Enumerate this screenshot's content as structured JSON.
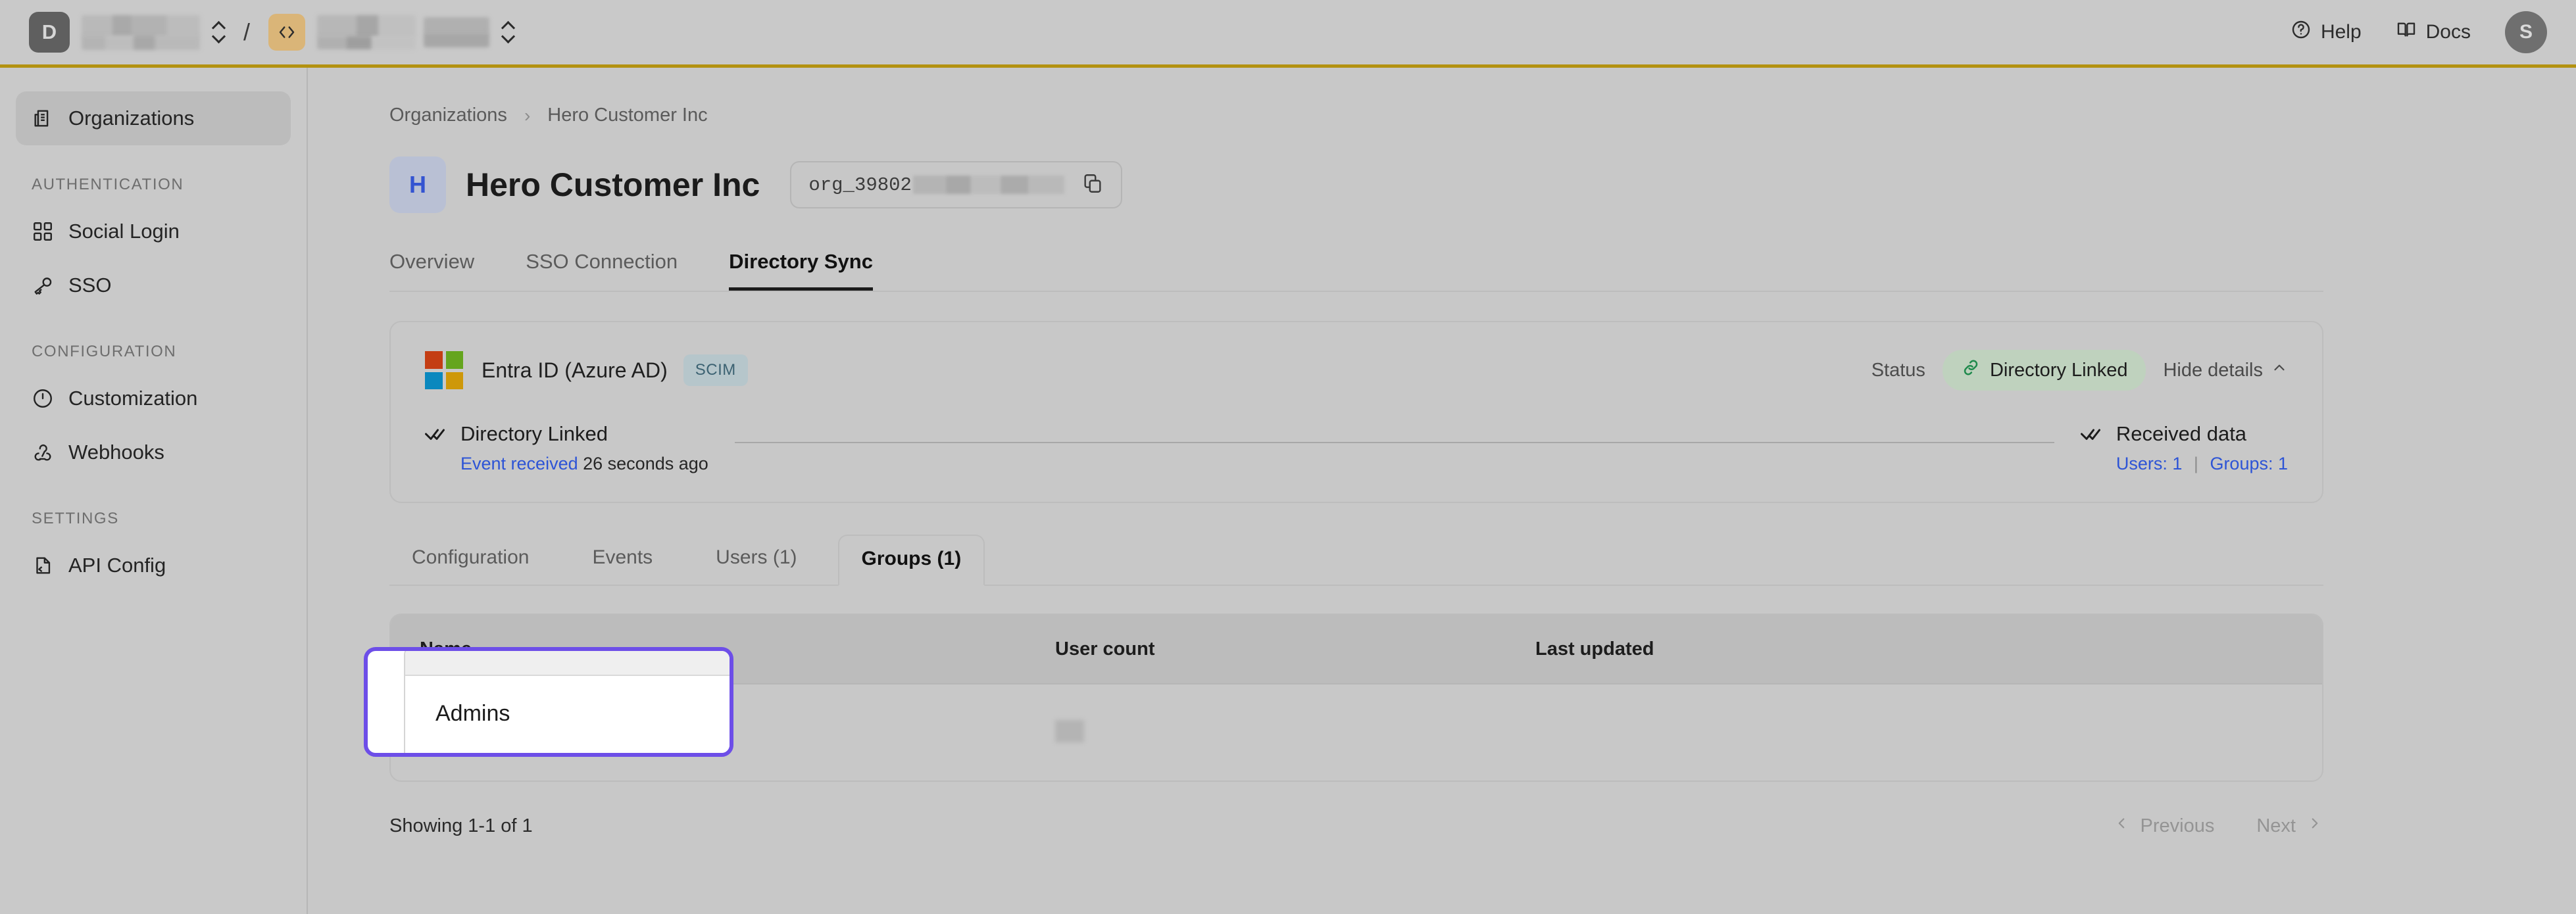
{
  "topbar": {
    "workspace_avatar": "D",
    "workspace_name_redacted": "",
    "separator": "/",
    "code_icon": "code-brackets-icon",
    "project_name_redacted": "",
    "help_label": "Help",
    "docs_label": "Docs",
    "user_avatar": "S",
    "accent_color": "#b39211"
  },
  "sidebar": {
    "items": [
      {
        "label": "Organizations",
        "icon": "organizations-icon",
        "active": true
      }
    ],
    "sections": [
      {
        "title": "AUTHENTICATION",
        "items": [
          {
            "label": "Social Login",
            "icon": "grid-icon"
          },
          {
            "label": "SSO",
            "icon": "key-icon"
          }
        ]
      },
      {
        "title": "CONFIGURATION",
        "items": [
          {
            "label": "Customization",
            "icon": "palette-icon"
          },
          {
            "label": "Webhooks",
            "icon": "webhook-icon"
          }
        ]
      },
      {
        "title": "SETTINGS",
        "items": [
          {
            "label": "API Config",
            "icon": "api-file-icon"
          }
        ]
      }
    ]
  },
  "breadcrumb": {
    "root": "Organizations",
    "separator": "›",
    "current": "Hero Customer Inc"
  },
  "org": {
    "badge_letter": "H",
    "title": "Hero Customer Inc",
    "id_prefix": "org_39802",
    "copy_icon": "copy-icon"
  },
  "tabs": [
    {
      "label": "Overview",
      "active": false
    },
    {
      "label": "SSO Connection",
      "active": false
    },
    {
      "label": "Directory Sync",
      "active": true
    }
  ],
  "directory": {
    "provider": "Entra ID (Azure AD)",
    "protocol_badge": "SCIM",
    "status_label": "Status",
    "status_value": "Directory Linked",
    "status_icon": "link-icon",
    "status_color": "#bfd2be",
    "toggle_details": "Hide details",
    "toggle_icon": "chevron-up-icon",
    "steps": [
      {
        "title": "Directory Linked",
        "icon": "double-check-icon",
        "link_text": "Event received",
        "sub_text": "26 seconds ago"
      },
      {
        "title": "Received data",
        "icon": "double-check-icon",
        "users_label": "Users: 1",
        "groups_label": "Groups: 1",
        "divider": "|"
      }
    ],
    "ms_colors": {
      "red": "#c43e14",
      "green": "#65a51e",
      "blue": "#0a88be",
      "yellow": "#ce9809"
    }
  },
  "subtabs": [
    {
      "label": "Configuration",
      "active": false
    },
    {
      "label": "Events",
      "active": false
    },
    {
      "label": "Users (1)",
      "active": false
    },
    {
      "label": "Groups (1)",
      "active": true
    }
  ],
  "groups_table": {
    "columns": [
      "Name",
      "User count",
      "Last updated"
    ],
    "rows": [
      {
        "name": "Admins",
        "user_count": "",
        "last_updated": ""
      }
    ]
  },
  "pagination": {
    "showing": "Showing 1-1 of 1",
    "previous": "Previous",
    "next": "Next",
    "prev_icon": "chevron-left-icon",
    "next_icon": "chevron-right-icon"
  },
  "magnifier": {
    "highlight_color": "#6d4ee8",
    "zoomed_text": "Admins"
  }
}
